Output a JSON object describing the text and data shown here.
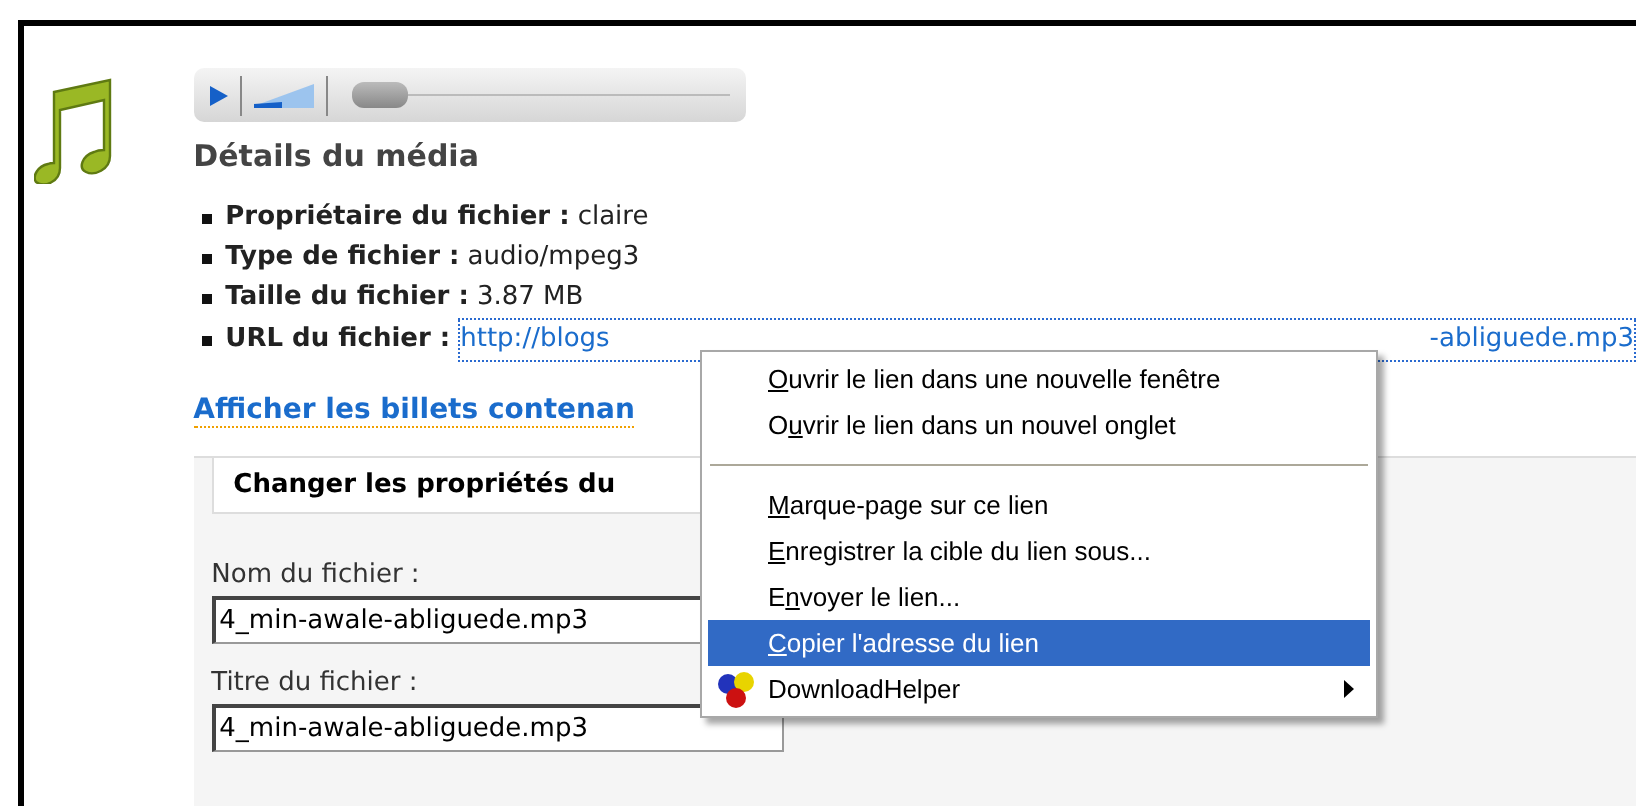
{
  "player": {
    "level": 0
  },
  "media_details": {
    "title": "Détails du média",
    "properties": [
      {
        "label": "Propriétaire du fichier :",
        "value": "claire"
      },
      {
        "label": "Type de fichier :",
        "value": "audio/mpeg3"
      },
      {
        "label": "Taille du fichier :",
        "value": "3.87 MB"
      }
    ],
    "url": {
      "label": "URL du fichier :",
      "link_start": "http://blogs",
      "link_end": "-abliguede.mp3"
    }
  },
  "posts_link": "Afficher les billets contenan",
  "properties_panel": {
    "tab": "Changer les propriétés du",
    "fields": [
      {
        "label": "Nom du fichier :",
        "value": "4_min-awale-abliguede.mp3"
      },
      {
        "label": "Titre du fichier :",
        "value": "4_min-awale-abliguede.mp3"
      }
    ]
  },
  "context_menu": [
    {
      "kind": "item",
      "mnemonic": "O",
      "after": "uvrir le lien dans une nouvelle fenêtre",
      "selected": false
    },
    {
      "kind": "item",
      "before": "O",
      "mnemonic": "u",
      "after": "vrir le lien dans un nouvel onglet",
      "selected": false
    },
    {
      "kind": "separator"
    },
    {
      "kind": "item",
      "mnemonic": "M",
      "after": "arque-page sur ce lien",
      "selected": false
    },
    {
      "kind": "item",
      "mnemonic": "E",
      "after": "nregistrer la cible du lien sous...",
      "selected": false
    },
    {
      "kind": "item",
      "before": "E",
      "mnemonic": "n",
      "after": "voyer le lien...",
      "selected": false
    },
    {
      "kind": "item",
      "mnemonic": "C",
      "after": "opier l'adresse du lien",
      "selected": true
    },
    {
      "kind": "submenu",
      "after": "DownloadHelper",
      "selected": false
    }
  ]
}
